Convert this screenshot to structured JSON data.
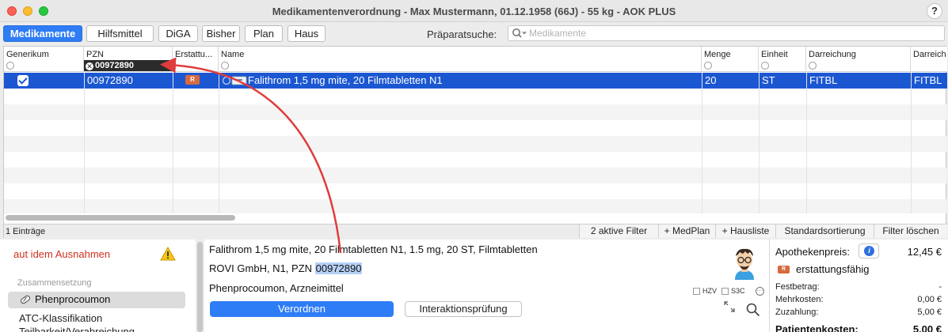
{
  "window": {
    "title": "Medikamentenverordnung - Max Mustermann, 01.12.1958 (66J) - 55 kg - AOK PLUS",
    "help": "?"
  },
  "toolbar": {
    "tabs": [
      {
        "label": "Medikamente",
        "active": true
      },
      {
        "label": "Hilfsmittel",
        "active": false
      },
      {
        "label": "DiGA",
        "active": false
      },
      {
        "label": "Bisher",
        "active": false
      },
      {
        "label": "Plan",
        "active": false
      },
      {
        "label": "Haus",
        "active": false
      }
    ],
    "search_label": "Präparatsuche:",
    "search_placeholder": "Medikamente",
    "search_value": ""
  },
  "table": {
    "columns": [
      "Generikum",
      "PZN",
      "Erstattu...",
      "Name",
      "Menge",
      "Einheit",
      "Darreichung",
      "Darreich"
    ],
    "pzn_filter": "00972890",
    "rows": [
      {
        "generikum": true,
        "pzn": "00972890",
        "erstattung_badge": "R",
        "name": "Falithrom 1,5 mg mite, 20 Filmtabletten N1",
        "menge": "20",
        "einheit": "ST",
        "darreichung": "FITBL",
        "darreichung2": "FITBL"
      }
    ],
    "count": "1 Einträge",
    "footer_buttons": [
      "2 aktive Filter",
      "+ MedPlan",
      "+ Hausliste",
      "Standardsortierung",
      "Filter löschen"
    ]
  },
  "left": {
    "aut_idem": "aut idem Ausnahmen",
    "section": "Zusammensetzung",
    "ingredient": "Phenprocoumon",
    "atc": "ATC-Klassifikation",
    "teilbarkeit": "Teilbarkeit/Verabreichung"
  },
  "detail": {
    "line1": "Falithrom 1,5 mg mite, 20 Filmtabletten N1, 1.5 mg, 20 ST, Filmtabletten",
    "line2_prefix": "ROVI GmbH, N1, PZN ",
    "line2_pzn": "00972890",
    "line3": "Phenprocoumon, Arzneimittel",
    "hzv": "HZV",
    "s3c": "S3C",
    "verordnen": "Verordnen",
    "interaktion": "Interaktionsprüfung"
  },
  "pricing": {
    "apothekenpreis_label": "Apothekenpreis:",
    "apothekenpreis": "12,45 €",
    "erstattung": "erstattungsfähig",
    "erstattung_badge": "R",
    "festbetrag_label": "Festbetrag:",
    "festbetrag": "-",
    "mehrkosten_label": "Mehrkosten:",
    "mehrkosten": "0,00 €",
    "zuzahlung_label": "Zuzahlung:",
    "zuzahlung": "5,00 €",
    "patientenkosten_label": "Patientenkosten:",
    "patientenkosten": "5,00 €"
  },
  "colors": {
    "accent": "#2e7cf6",
    "selection": "#1c57d2",
    "annotation_arrow": "#e03c3c",
    "warning_red": "#d03020"
  }
}
